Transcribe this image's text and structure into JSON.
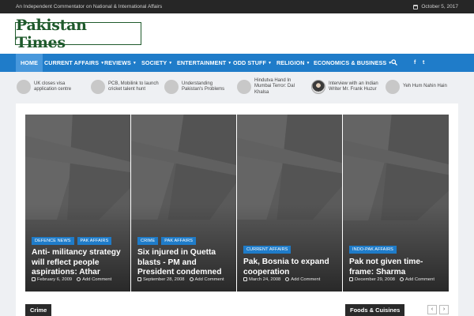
{
  "topbar": {
    "tagline": "An Independent Commentator on National & International Affairs",
    "date": "October 5, 2017"
  },
  "header": {
    "logo_text": "Pakistan Times"
  },
  "nav": {
    "items": [
      {
        "label": "HOME"
      },
      {
        "label": "CURRENT AFFAIRS"
      },
      {
        "label": "REVIEWS"
      },
      {
        "label": "SOCIETY"
      },
      {
        "label": "ENTERTAINMENT"
      },
      {
        "label": "ODD STUFF"
      },
      {
        "label": "RELIGION"
      },
      {
        "label": "ECONOMICS & BUSINESS"
      }
    ],
    "caret": "▼",
    "social": {
      "facebook": "f",
      "twitter": "t"
    }
  },
  "ticker": [
    {
      "text": "UK closes visa application centre"
    },
    {
      "text": "PCB, Mobilink to launch cricket talent hunt"
    },
    {
      "text": "Understanding Pakistan's Problems"
    },
    {
      "text": "Hindutva Hand In Mumbai Terror: Dal Khalsa"
    },
    {
      "text": "Interview with an Indian Writer Mr. Frank Huzur"
    },
    {
      "text": "Yeh Hum Nahin Hain"
    }
  ],
  "slides": [
    {
      "categories": [
        "DEFENCE NEWS",
        "PAK AFFAIRS"
      ],
      "title": "Anti- militancy strategy will reflect people aspirations: Athar",
      "date": "February 6, 2009",
      "comment": "Add Comment"
    },
    {
      "categories": [
        "CRIME",
        "PAK AFFAIRS"
      ],
      "title": "Six injured in Quetta blasts - PM and President condemned",
      "date": "September 28, 2008",
      "comment": "Add Comment"
    },
    {
      "categories": [
        "CURRENT AFFAIRS"
      ],
      "title": "Pak, Bosnia to expand cooperation",
      "date": "March 24, 2008",
      "comment": "Add Comment"
    },
    {
      "categories": [
        "INDO-PAK AFFAIRS"
      ],
      "title": "Pak not given time-frame: Sharma",
      "date": "December 29, 2008",
      "comment": "Add Comment"
    }
  ],
  "sections": {
    "left": "Crime",
    "right": "Foods & Cuisines",
    "prev": "‹",
    "next": "›"
  },
  "colors": {
    "accent": "#1f7cc9",
    "topbar": "#262626",
    "logo_green": "#1f5a2c"
  }
}
